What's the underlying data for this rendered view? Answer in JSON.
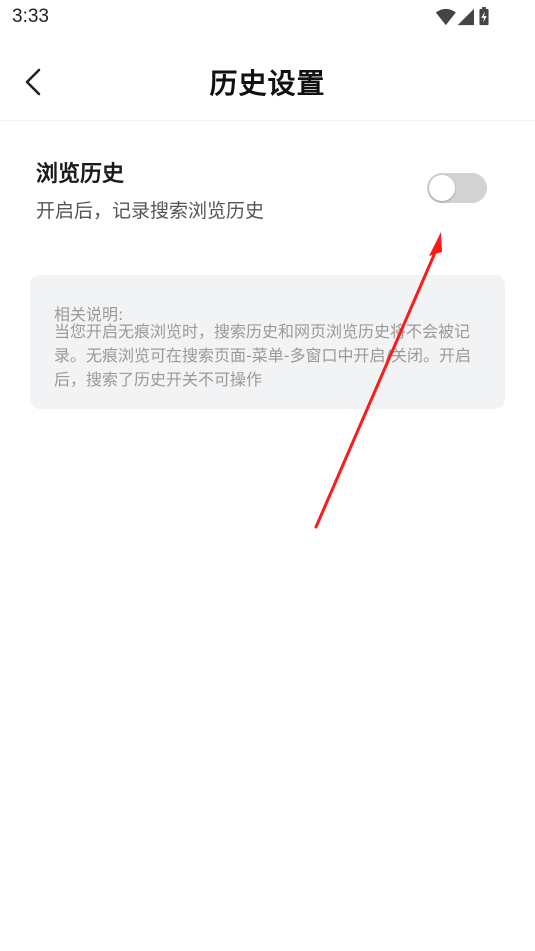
{
  "status_bar": {
    "time": "3:33",
    "icons": [
      "wifi-icon",
      "cell-signal-icon",
      "battery-charging-icon"
    ]
  },
  "header": {
    "back_icon": "chevron-left-icon",
    "title": "历史设置"
  },
  "setting": {
    "title": "浏览历史",
    "description": "开启后，记录搜索浏览历史",
    "toggle_on": false,
    "toggle_off_color": "#d2d2d2"
  },
  "info": {
    "label": "相关说明:",
    "text": "当您开启无痕浏览时，搜索历史和网页浏览历史将不会被记录。无痕浏览可在搜索页面-菜单-多窗口中开启/关闭。开启后，搜索了历史开关不可操作"
  },
  "annotation": {
    "arrow_color": "#ff1a1a"
  }
}
